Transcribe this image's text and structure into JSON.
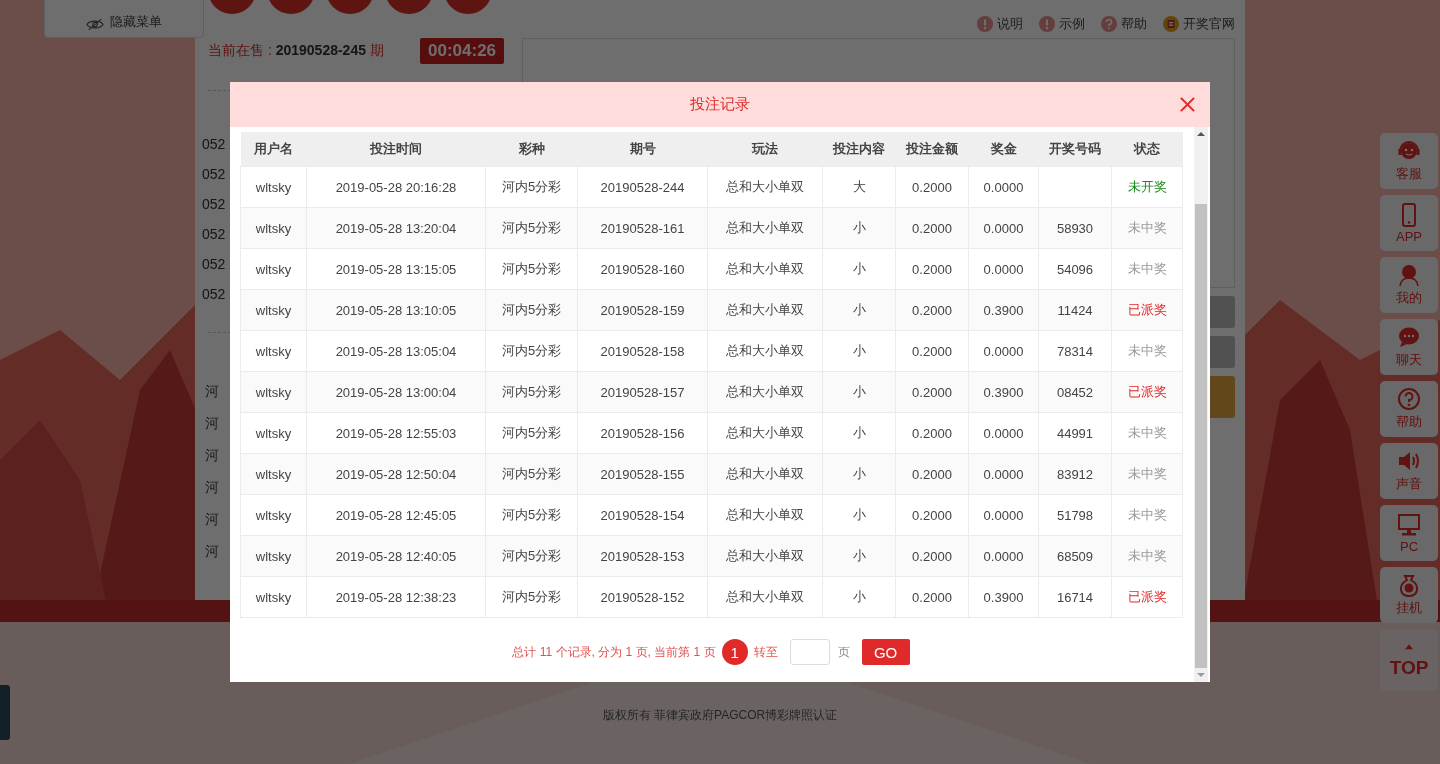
{
  "side_menu": {
    "label": "隐藏菜单"
  },
  "header_links": [
    "说明",
    "示例",
    "帮助",
    "开奖官网"
  ],
  "current_sale": {
    "label": "当前在售 :",
    "issue": "20190528-245",
    "suffix": "期",
    "countdown": "00:04:26"
  },
  "issue_list": [
    "052",
    "052",
    "052",
    "052",
    "052",
    "052"
  ],
  "lottery_list": [
    "河",
    "河",
    "河",
    "河",
    "河",
    "河"
  ],
  "side_rail": [
    {
      "label": "客服"
    },
    {
      "label": "APP"
    },
    {
      "label": "我的"
    },
    {
      "label": "聊天"
    },
    {
      "label": "帮助"
    },
    {
      "label": "声音"
    },
    {
      "label": "PC"
    },
    {
      "label": "挂机"
    },
    {
      "label": "TOP"
    }
  ],
  "footer": "版权所有 菲律宾政府PAGCOR博彩牌照认证",
  "dialog": {
    "title": "投注记录",
    "columns": [
      "用户名",
      "投注时间",
      "彩种",
      "期号",
      "玩法",
      "投注内容",
      "投注金额",
      "奖金",
      "开奖号码",
      "状态"
    ],
    "rows": [
      {
        "username": "wltsky",
        "time": "2019-05-28 20:16:28",
        "lottery": "河内5分彩",
        "issue": "20190528-244",
        "play": "总和大小单双",
        "content": "大",
        "amount": "0.2000",
        "bonus": "0.0000",
        "status": "未开奖",
        "kind": "pending"
      },
      {
        "username": "wltsky",
        "time": "2019-05-28 13:20:04",
        "lottery": "河内5分彩",
        "issue": "20190528-161",
        "play": "总和大小单双",
        "content": "小",
        "amount": "0.2000",
        "bonus": "0.0000",
        "result": "58930",
        "status": "未中奖",
        "kind": "lost"
      },
      {
        "username": "wltsky",
        "time": "2019-05-28 13:15:05",
        "lottery": "河内5分彩",
        "issue": "20190528-160",
        "play": "总和大小单双",
        "content": "小",
        "amount": "0.2000",
        "bonus": "0.0000",
        "result": "54096",
        "status": "未中奖",
        "kind": "lost"
      },
      {
        "username": "wltsky",
        "time": "2019-05-28 13:10:05",
        "lottery": "河内5分彩",
        "issue": "20190528-159",
        "play": "总和大小单双",
        "content": "小",
        "amount": "0.2000",
        "bonus": "0.3900",
        "result": "11424",
        "status": "已派奖",
        "kind": "paid"
      },
      {
        "username": "wltsky",
        "time": "2019-05-28 13:05:04",
        "lottery": "河内5分彩",
        "issue": "20190528-158",
        "play": "总和大小单双",
        "content": "小",
        "amount": "0.2000",
        "bonus": "0.0000",
        "result": "78314",
        "status": "未中奖",
        "kind": "lost"
      },
      {
        "username": "wltsky",
        "time": "2019-05-28 13:00:04",
        "lottery": "河内5分彩",
        "issue": "20190528-157",
        "play": "总和大小单双",
        "content": "小",
        "amount": "0.2000",
        "bonus": "0.3900",
        "result": "08452",
        "status": "已派奖",
        "kind": "paid"
      },
      {
        "username": "wltsky",
        "time": "2019-05-28 12:55:03",
        "lottery": "河内5分彩",
        "issue": "20190528-156",
        "play": "总和大小单双",
        "content": "小",
        "amount": "0.2000",
        "bonus": "0.0000",
        "result": "44991",
        "status": "未中奖",
        "kind": "lost"
      },
      {
        "username": "wltsky",
        "time": "2019-05-28 12:50:04",
        "lottery": "河内5分彩",
        "issue": "20190528-155",
        "play": "总和大小单双",
        "content": "小",
        "amount": "0.2000",
        "bonus": "0.0000",
        "result": "83912",
        "status": "未中奖",
        "kind": "lost"
      },
      {
        "username": "wltsky",
        "time": "2019-05-28 12:45:05",
        "lottery": "河内5分彩",
        "issue": "20190528-154",
        "play": "总和大小单双",
        "content": "小",
        "amount": "0.2000",
        "bonus": "0.0000",
        "result": "51798",
        "status": "未中奖",
        "kind": "lost"
      },
      {
        "username": "wltsky",
        "time": "2019-05-28 12:40:05",
        "lottery": "河内5分彩",
        "issue": "20190528-153",
        "play": "总和大小单双",
        "content": "小",
        "amount": "0.2000",
        "bonus": "0.0000",
        "result": "68509",
        "status": "未中奖",
        "kind": "lost"
      },
      {
        "username": "wltsky",
        "time": "2019-05-28 12:38:23",
        "lottery": "河内5分彩",
        "issue": "20190528-152",
        "play": "总和大小单双",
        "content": "小",
        "amount": "0.2000",
        "bonus": "0.3900",
        "result": "16714",
        "status": "已派奖",
        "kind": "paid"
      }
    ],
    "pagination": {
      "summary": "总计 11 个记录, 分为 1 页, 当前第 1 页",
      "pages": [
        {
          "label": "1",
          "selected": true
        }
      ],
      "goto_label": "转至",
      "page_unit": "页",
      "go_button": "GO"
    }
  }
}
